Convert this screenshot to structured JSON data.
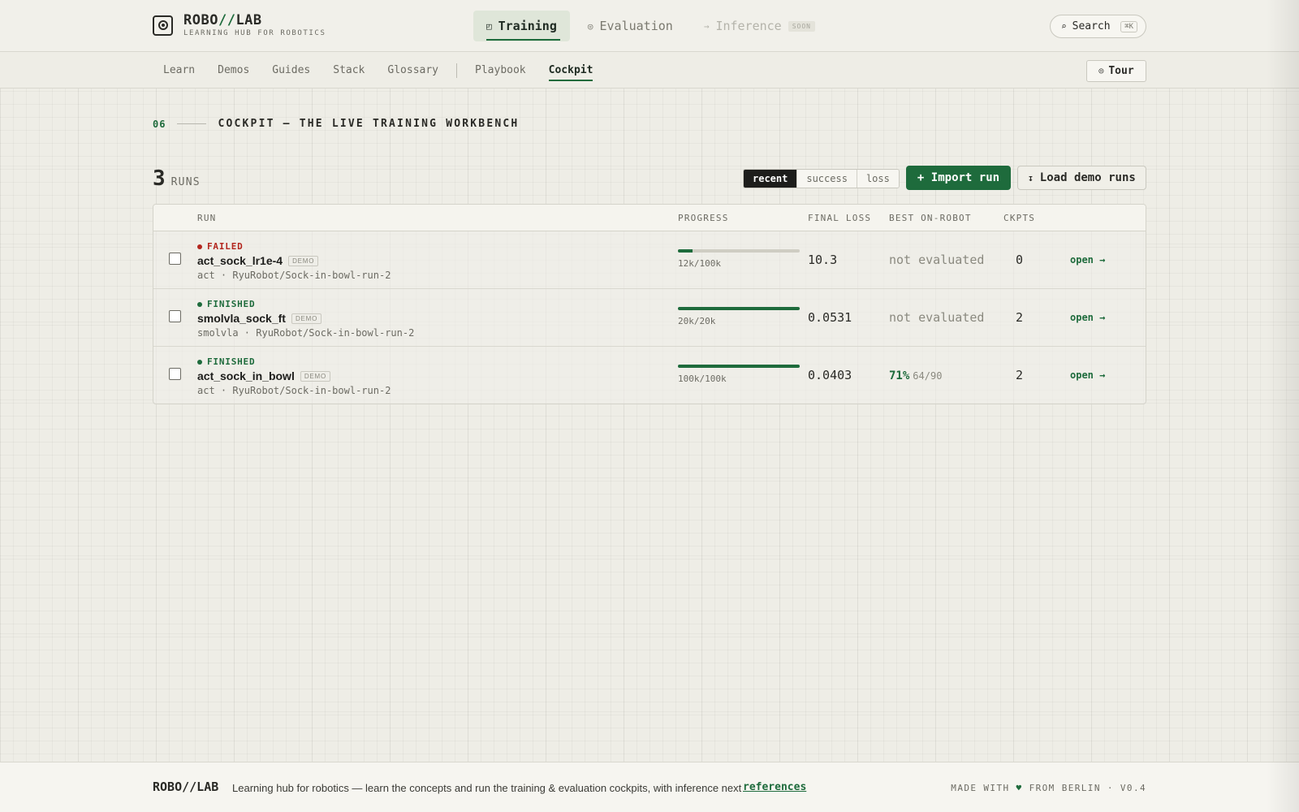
{
  "brand": {
    "name_a": "ROBO",
    "name_slash": "//",
    "name_b": "LAB",
    "tagline": "LEARNING HUB FOR ROBOTICS"
  },
  "mode_tabs": [
    {
      "label": "Training",
      "icon": "training-icon",
      "state": "active"
    },
    {
      "label": "Evaluation",
      "icon": "evaluation-icon",
      "state": "normal"
    },
    {
      "label": "Inference",
      "icon": "arrow-icon",
      "state": "disabled",
      "badge": "SOON"
    }
  ],
  "search": {
    "label": "Search",
    "shortcut": "⌘K",
    "icon": "search-icon"
  },
  "subnav": {
    "items": [
      "Learn",
      "Demos",
      "Guides",
      "Stack",
      "Glossary"
    ],
    "items_b": [
      "Playbook",
      "Cockpit"
    ],
    "active": "Cockpit"
  },
  "tour": {
    "label": "Tour",
    "icon": "tour-icon"
  },
  "section": {
    "number": "06",
    "title": "COCKPIT — THE LIVE TRAINING WORKBENCH"
  },
  "runs": {
    "count": "3",
    "label": "RUNS"
  },
  "sort": {
    "options": [
      "recent",
      "success",
      "loss"
    ],
    "active": "recent"
  },
  "actions": {
    "import": "+ Import run",
    "load_demo": "Load demo runs",
    "load_demo_icon": "download-icon"
  },
  "table": {
    "headers": {
      "run": "RUN",
      "progress": "PROGRESS",
      "final_loss": "FINAL LOSS",
      "best": "BEST ON-ROBOT",
      "ckpts": "CKPTS"
    },
    "rows": [
      {
        "status": "FAILED",
        "status_color": "#b3261e",
        "name": "act_sock_lr1e-4",
        "badge": "DEMO",
        "sub": "act · RyuRobot/Sock-in-bowl-run-2",
        "progress_label": "12k/100k",
        "progress_fraction": 0.12,
        "final_loss": "10.3",
        "best_text": "not evaluated",
        "best_pct": "",
        "best_frac": "",
        "ckpts": "0",
        "open": "open →"
      },
      {
        "status": "FINISHED",
        "status_color": "#1e6b3c",
        "name": "smolvla_sock_ft",
        "badge": "DEMO",
        "sub": "smolvla · RyuRobot/Sock-in-bowl-run-2",
        "progress_label": "20k/20k",
        "progress_fraction": 1.0,
        "final_loss": "0.0531",
        "best_text": "not evaluated",
        "best_pct": "",
        "best_frac": "",
        "ckpts": "2",
        "open": "open →"
      },
      {
        "status": "FINISHED",
        "status_color": "#1e6b3c",
        "name": "act_sock_in_bowl",
        "badge": "DEMO",
        "sub": "act · RyuRobot/Sock-in-bowl-run-2",
        "progress_label": "100k/100k",
        "progress_fraction": 1.0,
        "final_loss": "0.0403",
        "best_text": "",
        "best_pct": "71%",
        "best_frac": "64/90",
        "ckpts": "2",
        "open": "open →"
      }
    ]
  },
  "footer": {
    "brand": "ROBO//LAB",
    "description": "Learning hub for robotics — learn the concepts and run the training & evaluation cockpits, with inference next",
    "link": "references",
    "made_with_a": "MADE WITH",
    "heart": "♥",
    "made_with_b": "FROM BERLIN · V0.4"
  },
  "colors": {
    "accent": "#1e6b3c",
    "failed": "#b3261e",
    "background": "#eeede6"
  }
}
